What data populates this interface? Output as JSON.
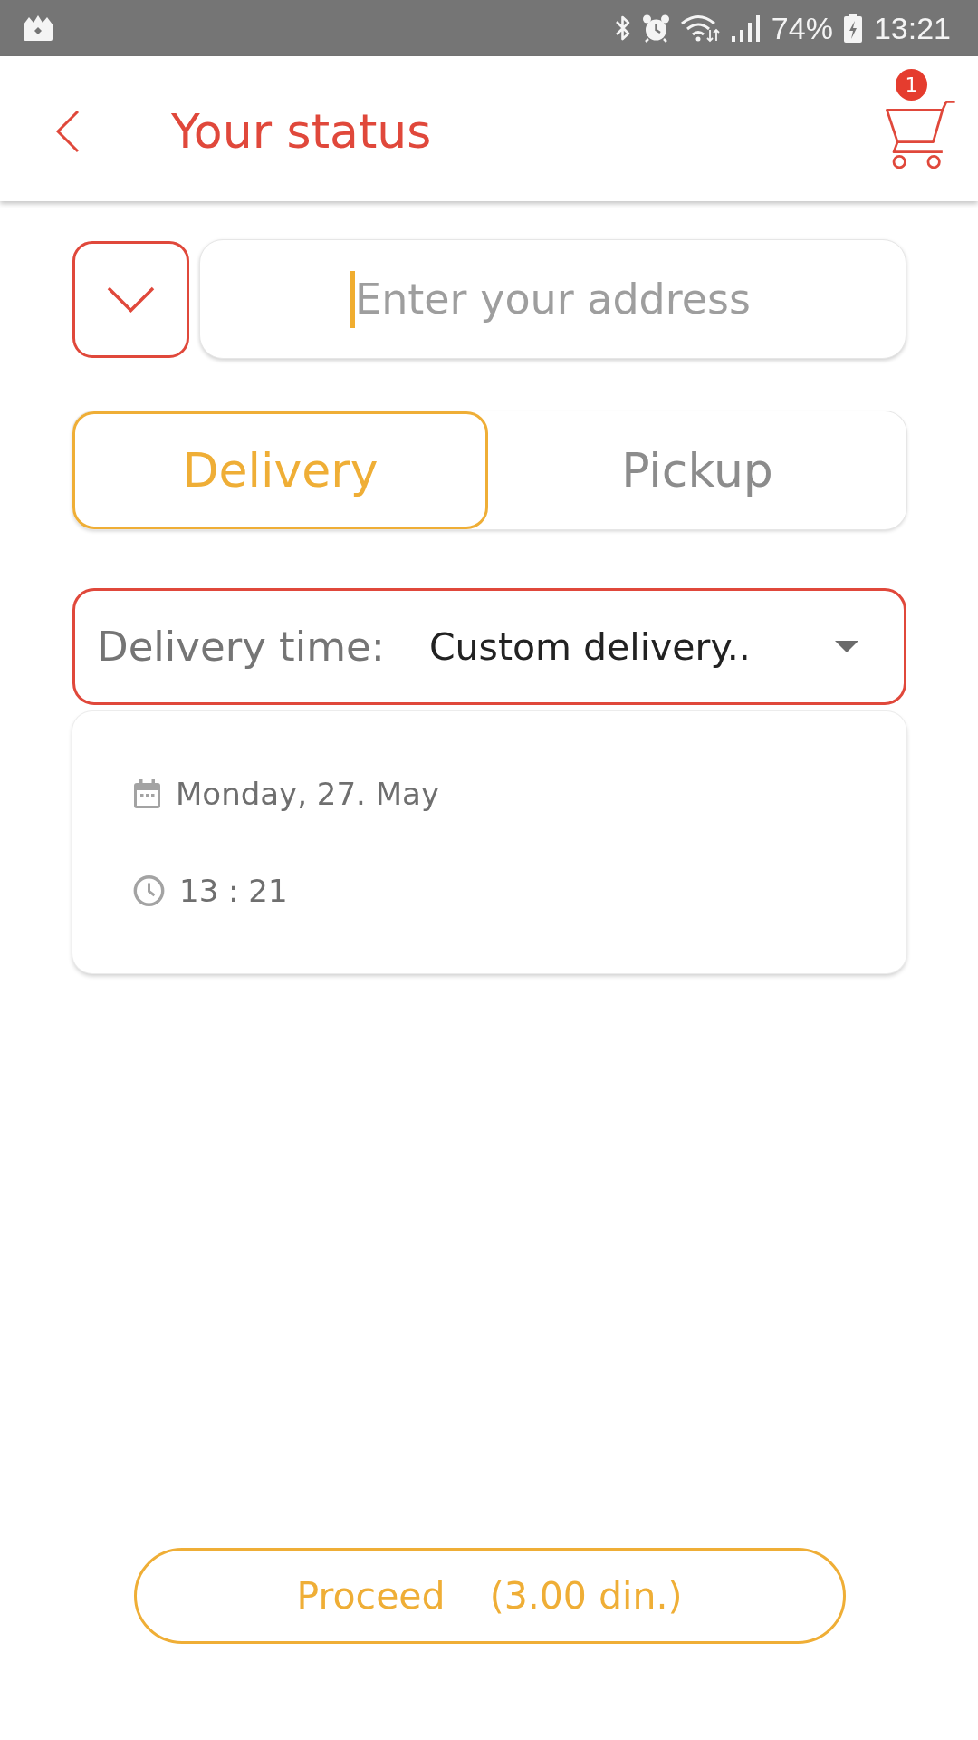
{
  "status_bar": {
    "battery": "74%",
    "time": "13:21"
  },
  "header": {
    "title": "Your status",
    "cart_count": "1"
  },
  "address": {
    "placeholder": "Enter your address",
    "focused": true
  },
  "mode_tabs": [
    {
      "label": "Delivery",
      "selected": true
    },
    {
      "label": "Pickup",
      "selected": false
    }
  ],
  "delivery_time": {
    "label": "Delivery time:",
    "value": "Custom delivery.."
  },
  "schedule": {
    "date": "Monday, 27. May",
    "time": "13 : 21"
  },
  "proceed_button": {
    "label": "Proceed",
    "price": "(3.00 din.)"
  }
}
